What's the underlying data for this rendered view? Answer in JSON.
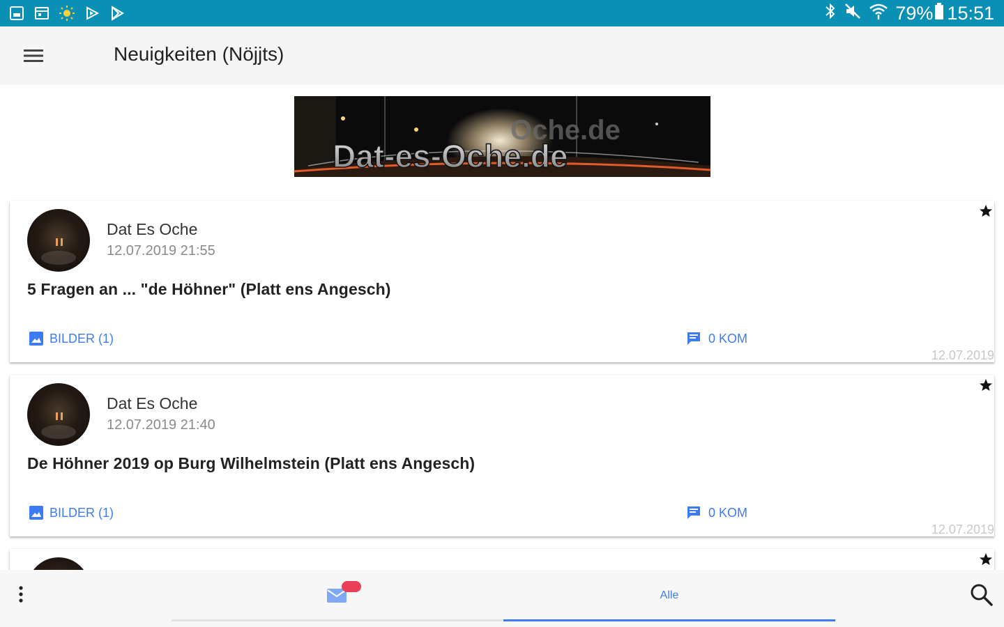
{
  "status_bar": {
    "battery": "79%",
    "time": "15:51",
    "icons": [
      "gallery-icon",
      "calendar-icon",
      "sun-icon",
      "play-store-icon",
      "play-store-alt-icon",
      "bluetooth-icon",
      "mute-icon",
      "wifi-icon",
      "battery-icon"
    ]
  },
  "app_bar": {
    "title": "Neuigkeiten (Nöjjts)"
  },
  "posts": [
    {
      "author": "Dat Es Oche",
      "datetime": "12.07.2019 21:55",
      "headline": "5 Fragen an ... \"de Höhner\" (Platt ens Angesch)",
      "pictures_label": "BILDER (1)",
      "comments_label": "0 KOM",
      "footer_date": "12.07.2019"
    },
    {
      "author": "Dat Es Oche",
      "datetime": "12.07.2019 21:40",
      "headline": "De Höhner 2019 op Burg Wilhelmstein (Platt ens Angesch)",
      "pictures_label": "BILDER (1)",
      "comments_label": "0 KOM",
      "footer_date": "12.07.2019"
    }
  ],
  "bottom_nav": {
    "tabs": [
      {
        "icon": "mail-icon",
        "label": ""
      },
      {
        "icon": "",
        "label": "Alle"
      }
    ],
    "accent_color": "#3d7cf0",
    "badge_color": "#e94057"
  },
  "colors": {
    "status_bar": "#0a8fb5",
    "link": "#3d7cf0"
  }
}
